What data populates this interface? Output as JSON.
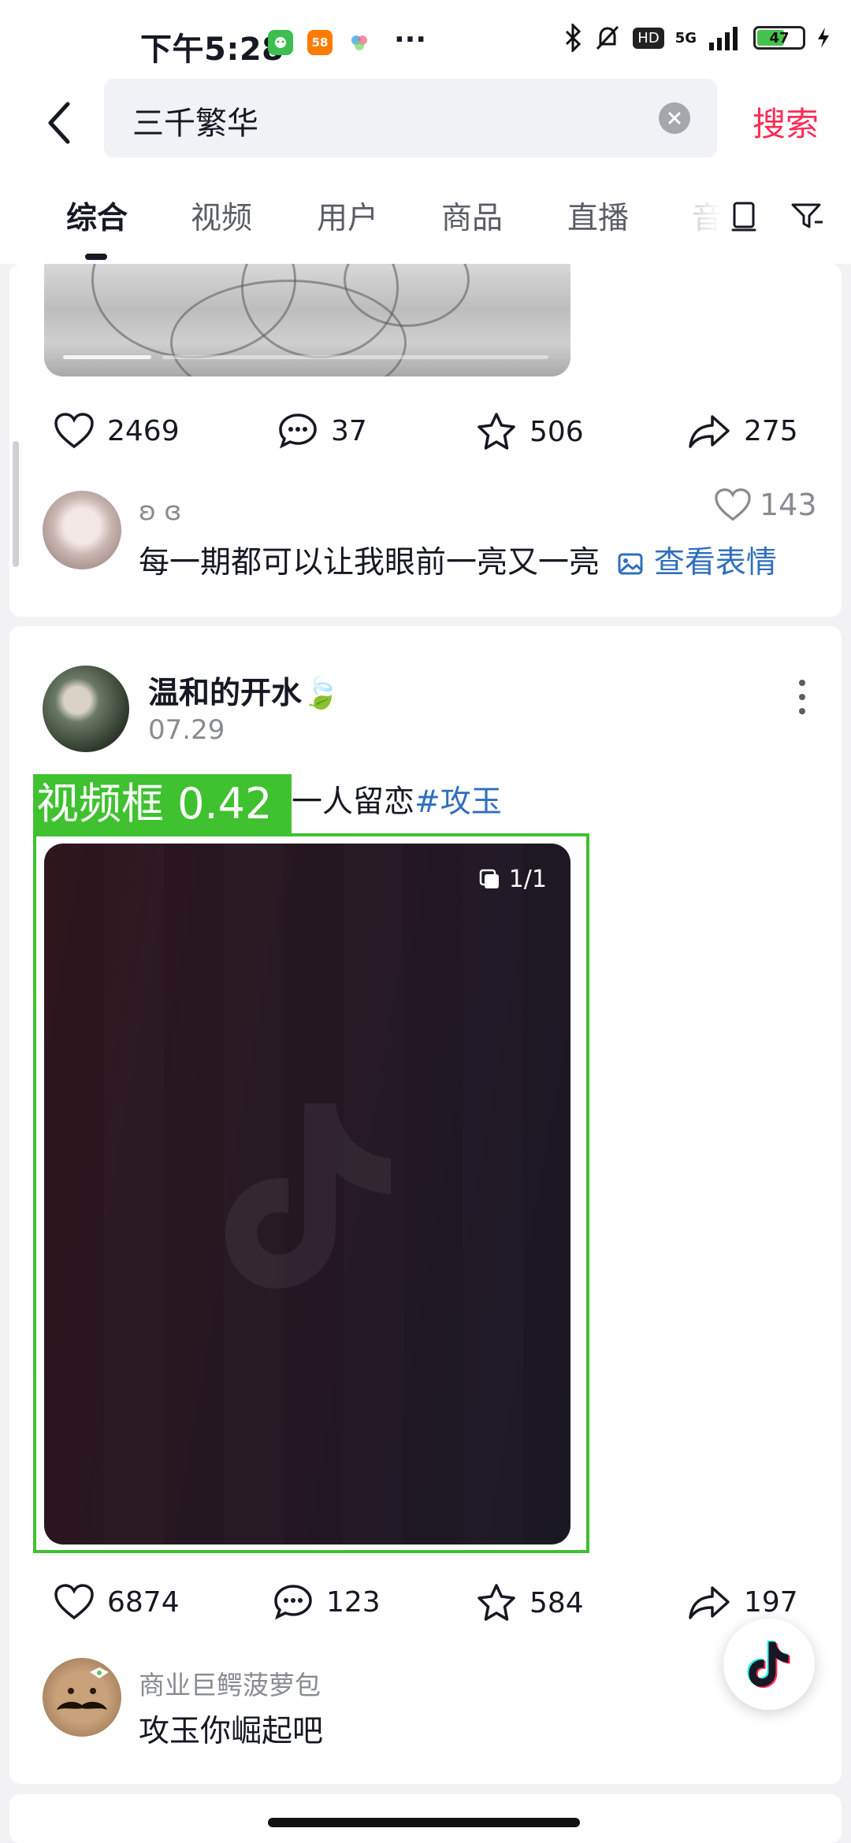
{
  "status_bar": {
    "time": "下午5:28",
    "apps": [
      {
        "icon": "green-app-icon",
        "text": "",
        "color": "#3dbe4f"
      },
      {
        "icon": "58-app-icon",
        "text": "58",
        "color": "#ff7a00"
      },
      {
        "icon": "flower-app-icon",
        "text": "",
        "color": "#3aa7e8"
      }
    ],
    "more": "···",
    "network": "5G",
    "hd": "HD",
    "battery": "47"
  },
  "search": {
    "query": "三千繁华",
    "submit_label": "搜索"
  },
  "tabs": [
    {
      "label": "综合",
      "active": true
    },
    {
      "label": "视频",
      "active": false
    },
    {
      "label": "用户",
      "active": false
    },
    {
      "label": "商品",
      "active": false
    },
    {
      "label": "直播",
      "active": false
    },
    {
      "label": "音",
      "active": false
    }
  ],
  "post1": {
    "actions": {
      "likes": "2469",
      "comments": "37",
      "favorites": "506",
      "shares": "275"
    },
    "top_comment": {
      "user": "ʚ ɞ",
      "text": "每一期都可以让我眼前一亮又一亮",
      "emoji_link": "查看表情",
      "likes": "143"
    }
  },
  "post2": {
    "author": "温和的开水🍃",
    "date": "07.29",
    "caption_visible": "一人留恋",
    "hashtag": "#攻玉",
    "overlay_label": "视频框 0.42",
    "video_counter": "1/1",
    "actions": {
      "likes": "6874",
      "comments": "123",
      "favorites": "584",
      "shares": "197"
    },
    "top_comment": {
      "user": "商业巨鳄菠萝包",
      "text": "攻玉你崛起吧"
    }
  },
  "colors": {
    "accent": "#fe2c55",
    "link": "#2f6fbd",
    "overlay": "#3fc130"
  }
}
